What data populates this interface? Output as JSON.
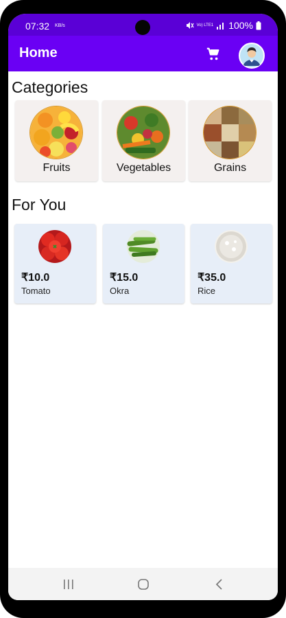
{
  "status": {
    "time": "07:32",
    "sub": "KB/s",
    "network": "Vo) LTE1",
    "battery": "100%"
  },
  "appbar": {
    "title": "Home",
    "cart_icon": "cart-icon",
    "avatar_icon": "user-avatar"
  },
  "categories": {
    "title": "Categories",
    "items": [
      {
        "label": "Fruits",
        "icon": "fruits-image"
      },
      {
        "label": "Vegetables",
        "icon": "vegetables-image"
      },
      {
        "label": "Grains",
        "icon": "grains-image"
      }
    ]
  },
  "for_you": {
    "title": "For You",
    "items": [
      {
        "price": "₹10.0",
        "name": "Tomato",
        "icon": "tomato-image"
      },
      {
        "price": "₹15.0",
        "name": "Okra",
        "icon": "okra-image"
      },
      {
        "price": "₹35.0",
        "name": "Rice",
        "icon": "rice-image"
      }
    ]
  },
  "colors": {
    "status_bar": "#5a00d6",
    "app_bar": "#6a00f4",
    "category_card": "#f4f0ef",
    "product_card": "#e7eef8"
  }
}
